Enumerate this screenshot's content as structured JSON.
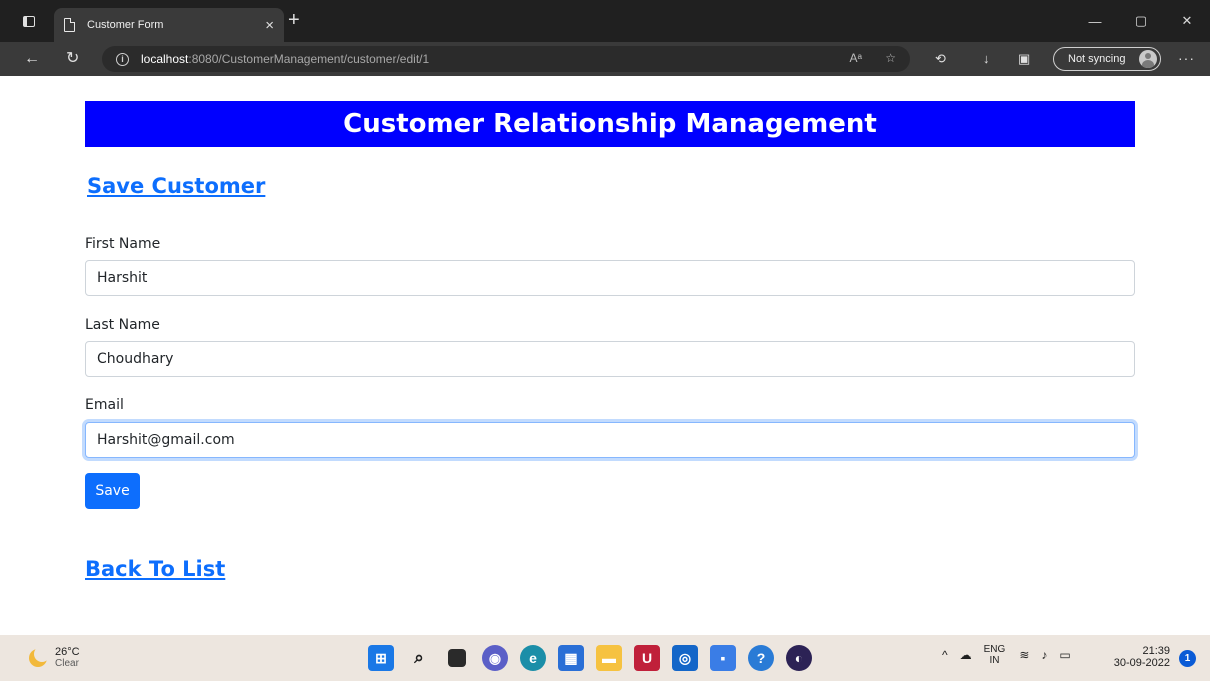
{
  "browser": {
    "tab_title": "Customer Form",
    "tab_close": "×",
    "new_tab": "+",
    "url_host": "localhost",
    "url_rest": ":8080/CustomerManagement/customer/edit/1",
    "sync_label": "Not syncing",
    "more_label": "···",
    "window_buttons": [
      "—",
      "▢",
      "✕"
    ]
  },
  "page": {
    "banner_title": "Customer Relationship Management",
    "heading": "Save Customer",
    "form": {
      "first_name_label": "First Name",
      "first_name_value": "Harshit",
      "last_name_label": "Last Name",
      "last_name_value": "Choudhary",
      "email_label": "Email",
      "email_value": "Harshit@gmail.com"
    },
    "save_button": "Save",
    "back_link": "Back To List"
  },
  "taskbar": {
    "temperature": "26°C",
    "condition": "Clear",
    "lang_top": "ENG",
    "lang_bottom": "IN",
    "time": "21:39",
    "date": "30-09-2022",
    "notification_count": "1"
  },
  "colors": {
    "banner": "#0000ff",
    "link": "#0d6efd",
    "button": "#0d6efd"
  }
}
